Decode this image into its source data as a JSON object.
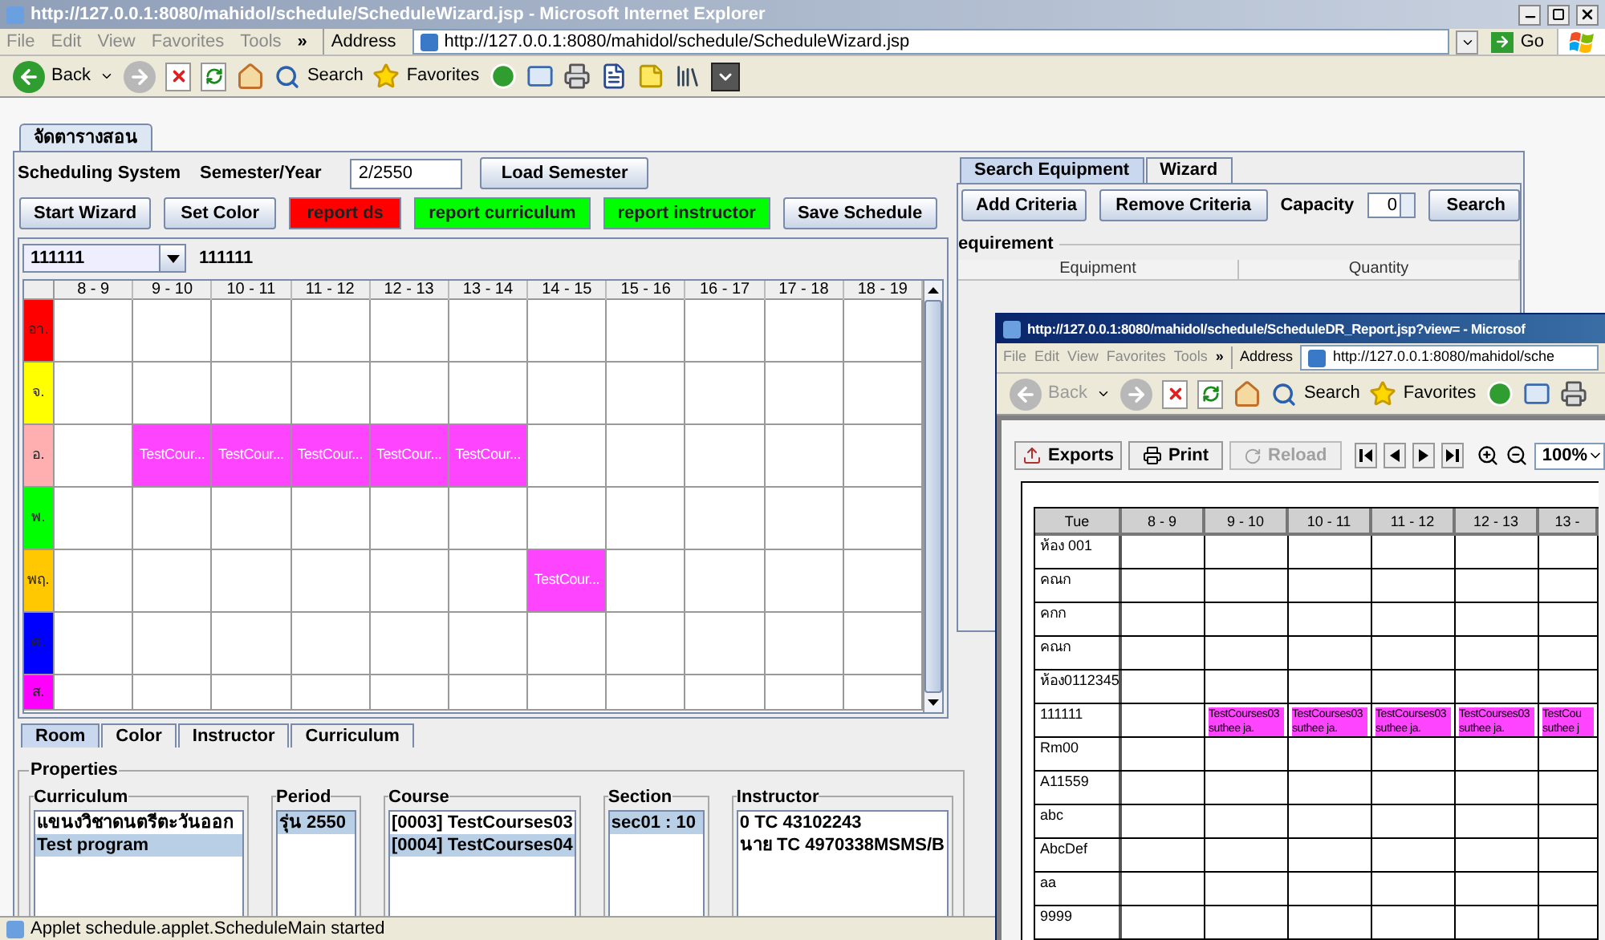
{
  "browser": {
    "title": "http://127.0.0.1:8080/mahidol/schedule/ScheduleWizard.jsp - Microsoft Internet Explorer",
    "menu": [
      "File",
      "Edit",
      "View",
      "Favorites",
      "Tools"
    ],
    "menu_more": "»",
    "address_label": "Address",
    "url": "http://127.0.0.1:8080/mahidol/schedule/ScheduleWizard.jsp",
    "go": "Go",
    "toolbar": {
      "back": "Back",
      "back_disabled": false,
      "search": "Search",
      "favorites": "Favorites"
    }
  },
  "applet": {
    "tab": "จัดตารางสอน",
    "system_label": "Scheduling System",
    "semester_label": "Semester/Year",
    "semester_value": "2/2550",
    "load_button": "Load Semester",
    "buttons": [
      {
        "label": "Start Wizard"
      },
      {
        "label": "Set Color"
      },
      {
        "label": "report ds",
        "color": "#ff0000"
      },
      {
        "label": "report curriculum",
        "color": "#00ff00"
      },
      {
        "label": "report instructor",
        "color": "#00ff00"
      },
      {
        "label": "Save Schedule"
      }
    ],
    "room_combo": "111111",
    "room_label": "111111",
    "grid": {
      "columns": [
        "8 - 9",
        "9 - 10",
        "10 - 11",
        "11 - 12",
        "12 - 13",
        "13 - 14",
        "14 - 15",
        "15 - 16",
        "16 - 17",
        "17 - 18",
        "18 - 19"
      ],
      "days": [
        {
          "label": "อา.",
          "color": "#ff0000",
          "cells": [
            null,
            null,
            null,
            null,
            null,
            null,
            null,
            null,
            null,
            null,
            null
          ]
        },
        {
          "label": "จ.",
          "color": "#ffff00",
          "cells": [
            null,
            null,
            null,
            null,
            null,
            null,
            null,
            null,
            null,
            null,
            null
          ]
        },
        {
          "label": "อ.",
          "color": "#ffafaf",
          "cells": [
            null,
            {
              "text": "TestCour...",
              "color": "#ff44ff"
            },
            {
              "text": "TestCour...",
              "color": "#ff44ff"
            },
            {
              "text": "TestCour...",
              "color": "#ff44ff"
            },
            {
              "text": "TestCour...",
              "color": "#ff44ff"
            },
            {
              "text": "TestCour...",
              "color": "#ff44ff"
            },
            null,
            null,
            null,
            null,
            null
          ]
        },
        {
          "label": "พ.",
          "color": "#00ff00",
          "cells": [
            null,
            null,
            null,
            null,
            null,
            null,
            null,
            null,
            null,
            null,
            null
          ]
        },
        {
          "label": "พฤ.",
          "color": "#ffc800",
          "cells": [
            null,
            null,
            null,
            null,
            null,
            null,
            {
              "text": "TestCour...",
              "color": "#ff44ff"
            },
            null,
            null,
            null,
            null
          ]
        },
        {
          "label": "ศ.",
          "color": "#0000ff",
          "cells": [
            null,
            null,
            null,
            null,
            null,
            null,
            null,
            null,
            null,
            null,
            null
          ]
        },
        {
          "label": "ส.",
          "color": "#ff00ff",
          "cells": [
            null,
            null,
            null,
            null,
            null,
            null,
            null,
            null,
            null,
            null,
            null
          ]
        }
      ]
    },
    "view_tabs": [
      {
        "label": "Room",
        "selected": true
      },
      {
        "label": "Color",
        "selected": false
      },
      {
        "label": "Instructor",
        "selected": false
      },
      {
        "label": "Curriculum",
        "selected": false
      }
    ],
    "properties": {
      "title": "Properties",
      "groups": [
        {
          "title": "Curriculum",
          "items": [
            {
              "text": "แขนงวิชาดนตรีตะวันออก",
              "selected": false
            },
            {
              "text": "Test program",
              "selected": true
            }
          ]
        },
        {
          "title": "Period",
          "items": [
            {
              "text": "รุ่น 2550",
              "selected": true
            }
          ]
        },
        {
          "title": "Course",
          "items": [
            {
              "text": "[0003] TestCourses03",
              "selected": false
            },
            {
              "text": "[0004] TestCourses04",
              "selected": true
            }
          ]
        },
        {
          "title": "Section",
          "items": [
            {
              "text": "sec01 : 10",
              "selected": true
            }
          ]
        },
        {
          "title": "Instructor",
          "items": [
            {
              "text": "0 TC 43102243",
              "selected": false
            },
            {
              "text": "นาย TC 4970338MSMS/B",
              "selected": false
            }
          ]
        }
      ]
    }
  },
  "equipment": {
    "tabs": [
      {
        "label": "Search Equipment",
        "selected": true
      },
      {
        "label": "Wizard",
        "selected": false
      }
    ],
    "buttons": [
      "Add Criteria",
      "Remove Criteria"
    ],
    "capacity_label": "Capacity",
    "capacity_value": "0",
    "search": "Search",
    "section_title": "equirement",
    "columns": [
      "Equipment",
      "Quantity"
    ]
  },
  "report_window": {
    "title": "http://127.0.0.1:8080/mahidol/schedule/ScheduleDR_Report.jsp?view= - Microsof",
    "menu": [
      "File",
      "Edit",
      "View",
      "Favorites",
      "Tools"
    ],
    "menu_more": "»",
    "address_label": "Address",
    "url": "http://127.0.0.1:8080/mahidol/sche",
    "toolbar": {
      "back": "Back",
      "back_disabled": true,
      "search": "Search",
      "favorites": "Favorites"
    },
    "report_toolbar": {
      "exports": "Exports",
      "print": "Print",
      "reload": "Reload",
      "reload_disabled": true,
      "zoom": "100%"
    },
    "table": {
      "corner": "Tue",
      "columns": [
        "8 - 9",
        "9 - 10",
        "10 - 11",
        "11 - 12",
        "12 - 13",
        "13 -"
      ],
      "rows": [
        {
          "room": "ห้อง 001"
        },
        {
          "room": "คณก"
        },
        {
          "room": "คกก"
        },
        {
          "room": "คณก"
        },
        {
          "room": "ห้อง0112345"
        },
        {
          "room": "111111",
          "cells": [
            null,
            {
              "course": "TestCourses03",
              "teacher": "suthee ja."
            },
            {
              "course": "TestCourses03",
              "teacher": "suthee ja."
            },
            {
              "course": "TestCourses03",
              "teacher": "suthee ja."
            },
            {
              "course": "TestCourses03",
              "teacher": "suthee ja."
            },
            {
              "course": "TestCou",
              "teacher": "suthee j"
            }
          ]
        },
        {
          "room": "Rm00"
        },
        {
          "room": "A11559"
        },
        {
          "room": "abc"
        },
        {
          "room": "AbcDef"
        },
        {
          "room": "aa"
        },
        {
          "room": "9999"
        }
      ]
    }
  },
  "status_bar": "Applet schedule.applet.ScheduleMain started"
}
